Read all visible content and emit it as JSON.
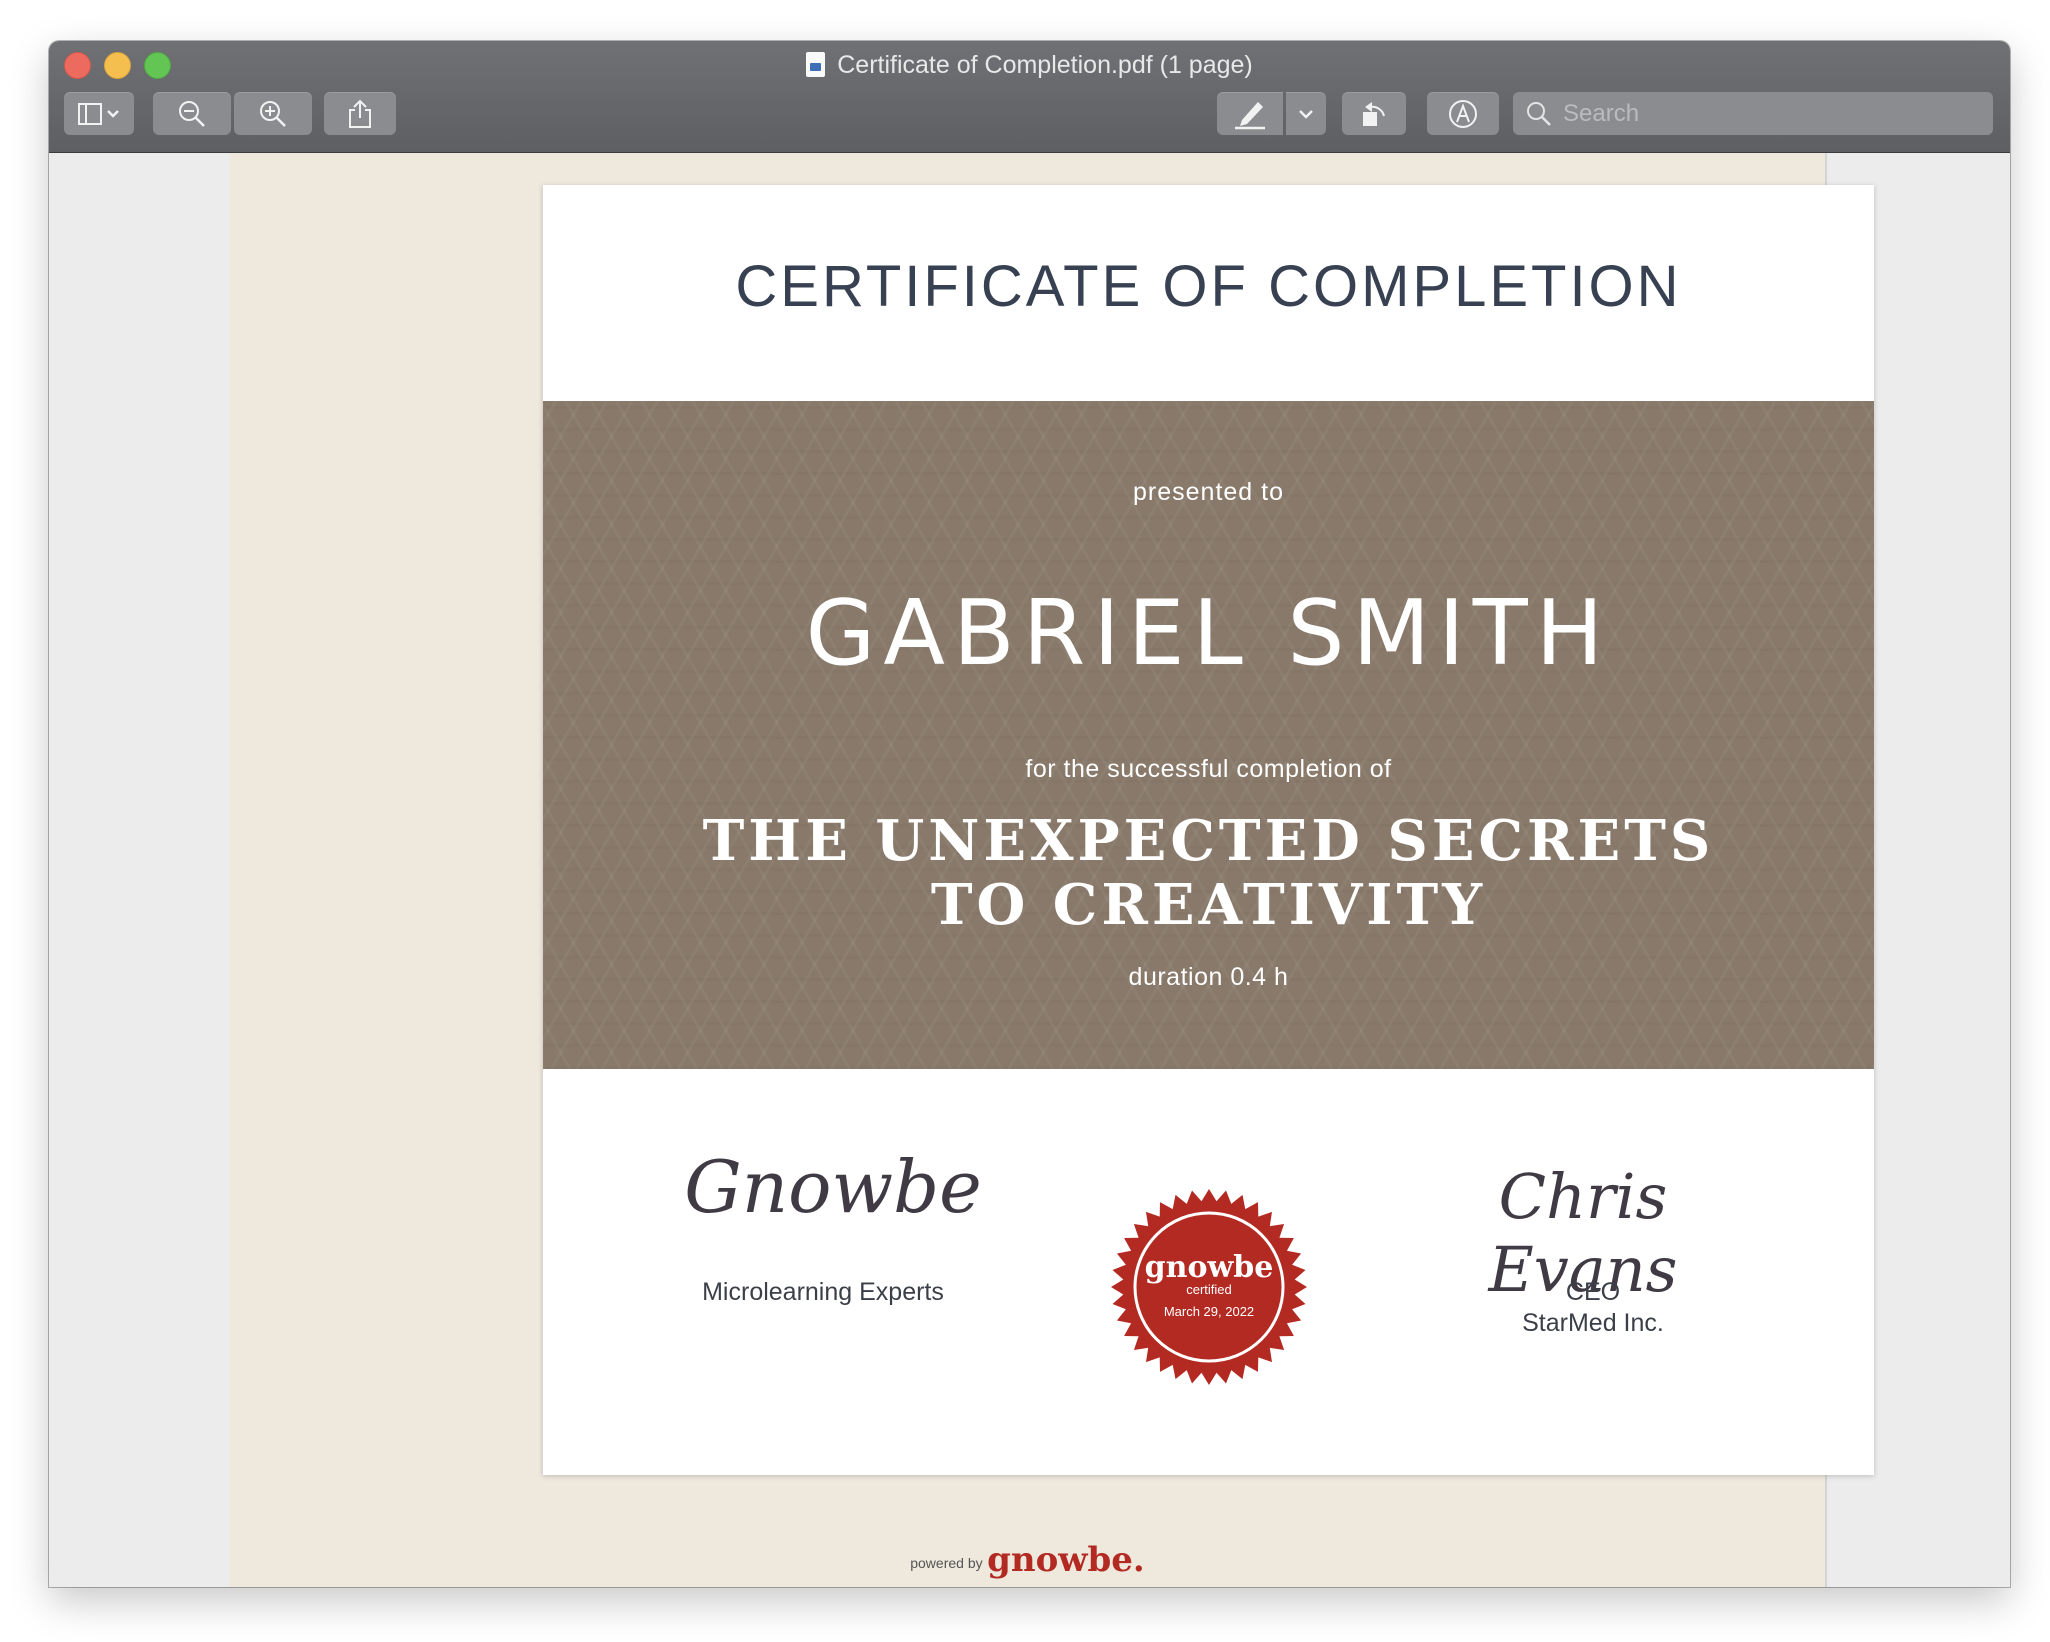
{
  "window": {
    "title": "Certificate of Completion.pdf (1 page)"
  },
  "toolbar": {
    "sidebar_icon": "sidebar-icon",
    "zoom_out_icon": "zoom-out-icon",
    "zoom_in_icon": "zoom-in-icon",
    "share_icon": "share-icon",
    "markup_icon": "pen-icon",
    "rotate_icon": "rotate-icon",
    "annotate_icon": "markup-icon",
    "search_placeholder": "Search"
  },
  "certificate": {
    "title": "CERTIFICATE OF COMPLETION",
    "presented_to": "presented to",
    "recipient": "GABRIEL SMITH",
    "for_text": "for the successful completion of",
    "course": "THE UNEXPECTED SECRETS TO CREATIVITY",
    "duration": "duration 0.4 h",
    "left_signature": "Gnowbe",
    "left_caption": "Microlearning Experts",
    "right_signature": "Chris  Evans",
    "right_caption_role": "CEO",
    "right_caption_company": "StarMed Inc.",
    "seal": {
      "brand": "gnowbe",
      "sub": "certified",
      "date": "March 29, 2022",
      "color": "#b32a23"
    }
  },
  "footer": {
    "powered_by": "powered by",
    "brand": "gnowbe."
  }
}
